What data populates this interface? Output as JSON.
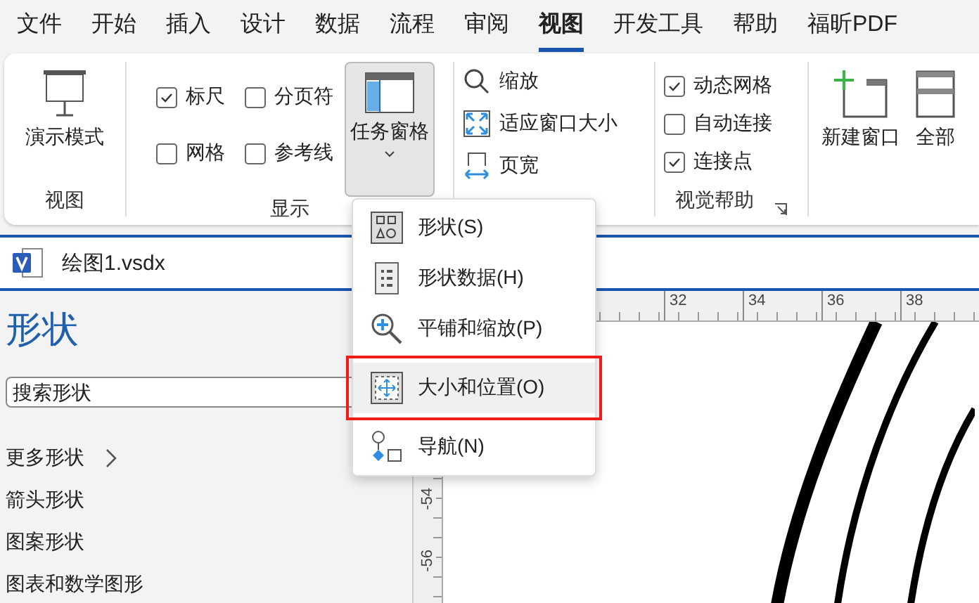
{
  "menu_tabs": [
    {
      "label": "文件",
      "selected": false
    },
    {
      "label": "开始",
      "selected": false
    },
    {
      "label": "插入",
      "selected": false
    },
    {
      "label": "设计",
      "selected": false
    },
    {
      "label": "数据",
      "selected": false
    },
    {
      "label": "流程",
      "selected": false
    },
    {
      "label": "审阅",
      "selected": false
    },
    {
      "label": "视图",
      "selected": true
    },
    {
      "label": "开发工具",
      "selected": false
    },
    {
      "label": "帮助",
      "selected": false
    },
    {
      "label": "福昕PDF",
      "selected": false
    }
  ],
  "ribbon": {
    "view_group": {
      "label": "视图",
      "button": "演示模式"
    },
    "show_group": {
      "label": "显示",
      "checkboxes": [
        {
          "label": "标尺",
          "checked": true
        },
        {
          "label": "分页符",
          "checked": false
        },
        {
          "label": "网格",
          "checked": false
        },
        {
          "label": "参考线",
          "checked": false
        }
      ],
      "task_pane_button": {
        "label": "任务窗格",
        "expanded": true
      }
    },
    "zoom_group": {
      "items": [
        "缩放",
        "适应窗口大小",
        "页宽"
      ]
    },
    "visual_aids_group": {
      "label": "视觉帮助",
      "checkboxes": [
        {
          "label": "动态网格",
          "checked": true
        },
        {
          "label": "自动连接",
          "checked": false
        },
        {
          "label": "连接点",
          "checked": true
        }
      ]
    },
    "window_group": {
      "items": [
        "新建窗口",
        "全部"
      ]
    }
  },
  "task_pane_menu": {
    "items": [
      {
        "label": "形状(S)",
        "outlined": false
      },
      {
        "label": "形状数据(H)",
        "outlined": false
      },
      {
        "label": "平铺和缩放(P)",
        "outlined": false
      },
      {
        "label": "大小和位置(O)",
        "outlined": true
      },
      {
        "label": "导航(N)",
        "outlined": false
      }
    ]
  },
  "document": {
    "title": "绘图1.vsdx"
  },
  "shapes_pane": {
    "title": "形状",
    "search": {
      "placeholder": "搜索形状"
    },
    "items": [
      {
        "label": "更多形状",
        "kind": "submenu"
      },
      {
        "label": "箭头形状",
        "kind": "stencil"
      },
      {
        "label": "图案形状",
        "kind": "stencil"
      },
      {
        "label": "图表和数学图形",
        "kind": "stencil"
      }
    ]
  },
  "ruler": {
    "horizontal": [
      "32",
      "34",
      "36",
      "38"
    ],
    "vertical": [
      "-54",
      "-56"
    ]
  }
}
